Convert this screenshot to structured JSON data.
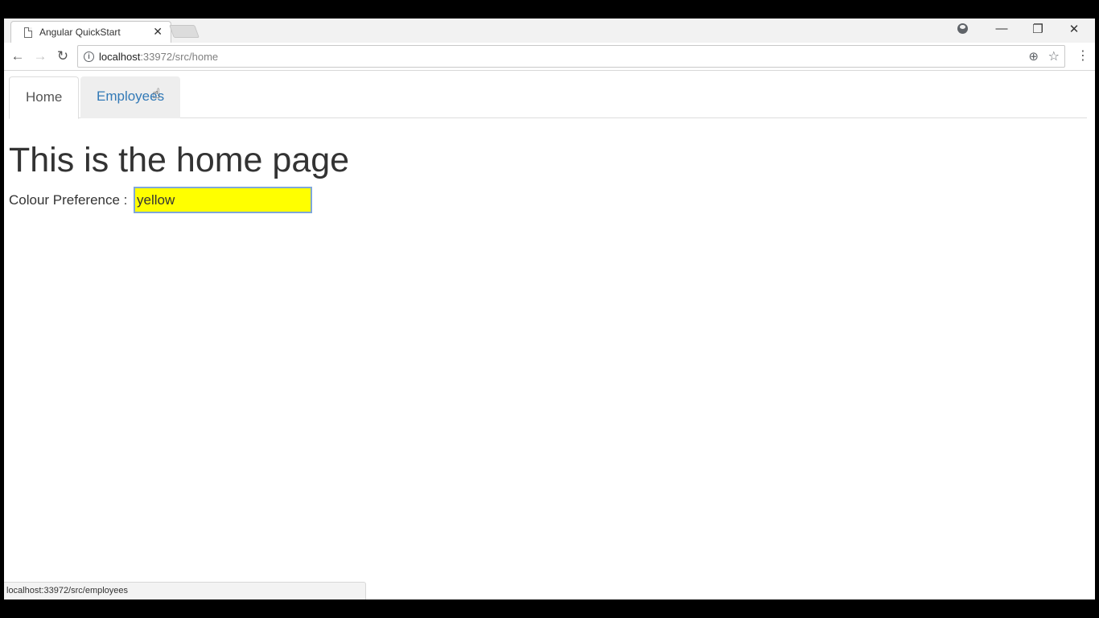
{
  "browser": {
    "tab_title": "Angular QuickStart",
    "url_host": "localhost",
    "url_rest": ":33972/src/home",
    "status_url": "localhost:33972/src/employees"
  },
  "nav": {
    "tabs": [
      {
        "label": "Home",
        "active": true
      },
      {
        "label": "Employees",
        "active": false
      }
    ]
  },
  "main": {
    "heading": "This is the home page",
    "colour_label": "Colour Preference :",
    "colour_value": "yellow"
  },
  "colors": {
    "input_background": "#ffff00",
    "link": "#337ab7"
  },
  "icons": {
    "page": "document-icon",
    "close": "close-icon",
    "profile": "profile-icon",
    "back": "back-arrow-icon",
    "forward": "forward-arrow-icon",
    "reload": "reload-icon",
    "info": "info-icon",
    "zoom": "zoom-icon",
    "star": "star-icon",
    "menu": "kebab-menu-icon",
    "cursor": "hand-cursor-icon"
  }
}
